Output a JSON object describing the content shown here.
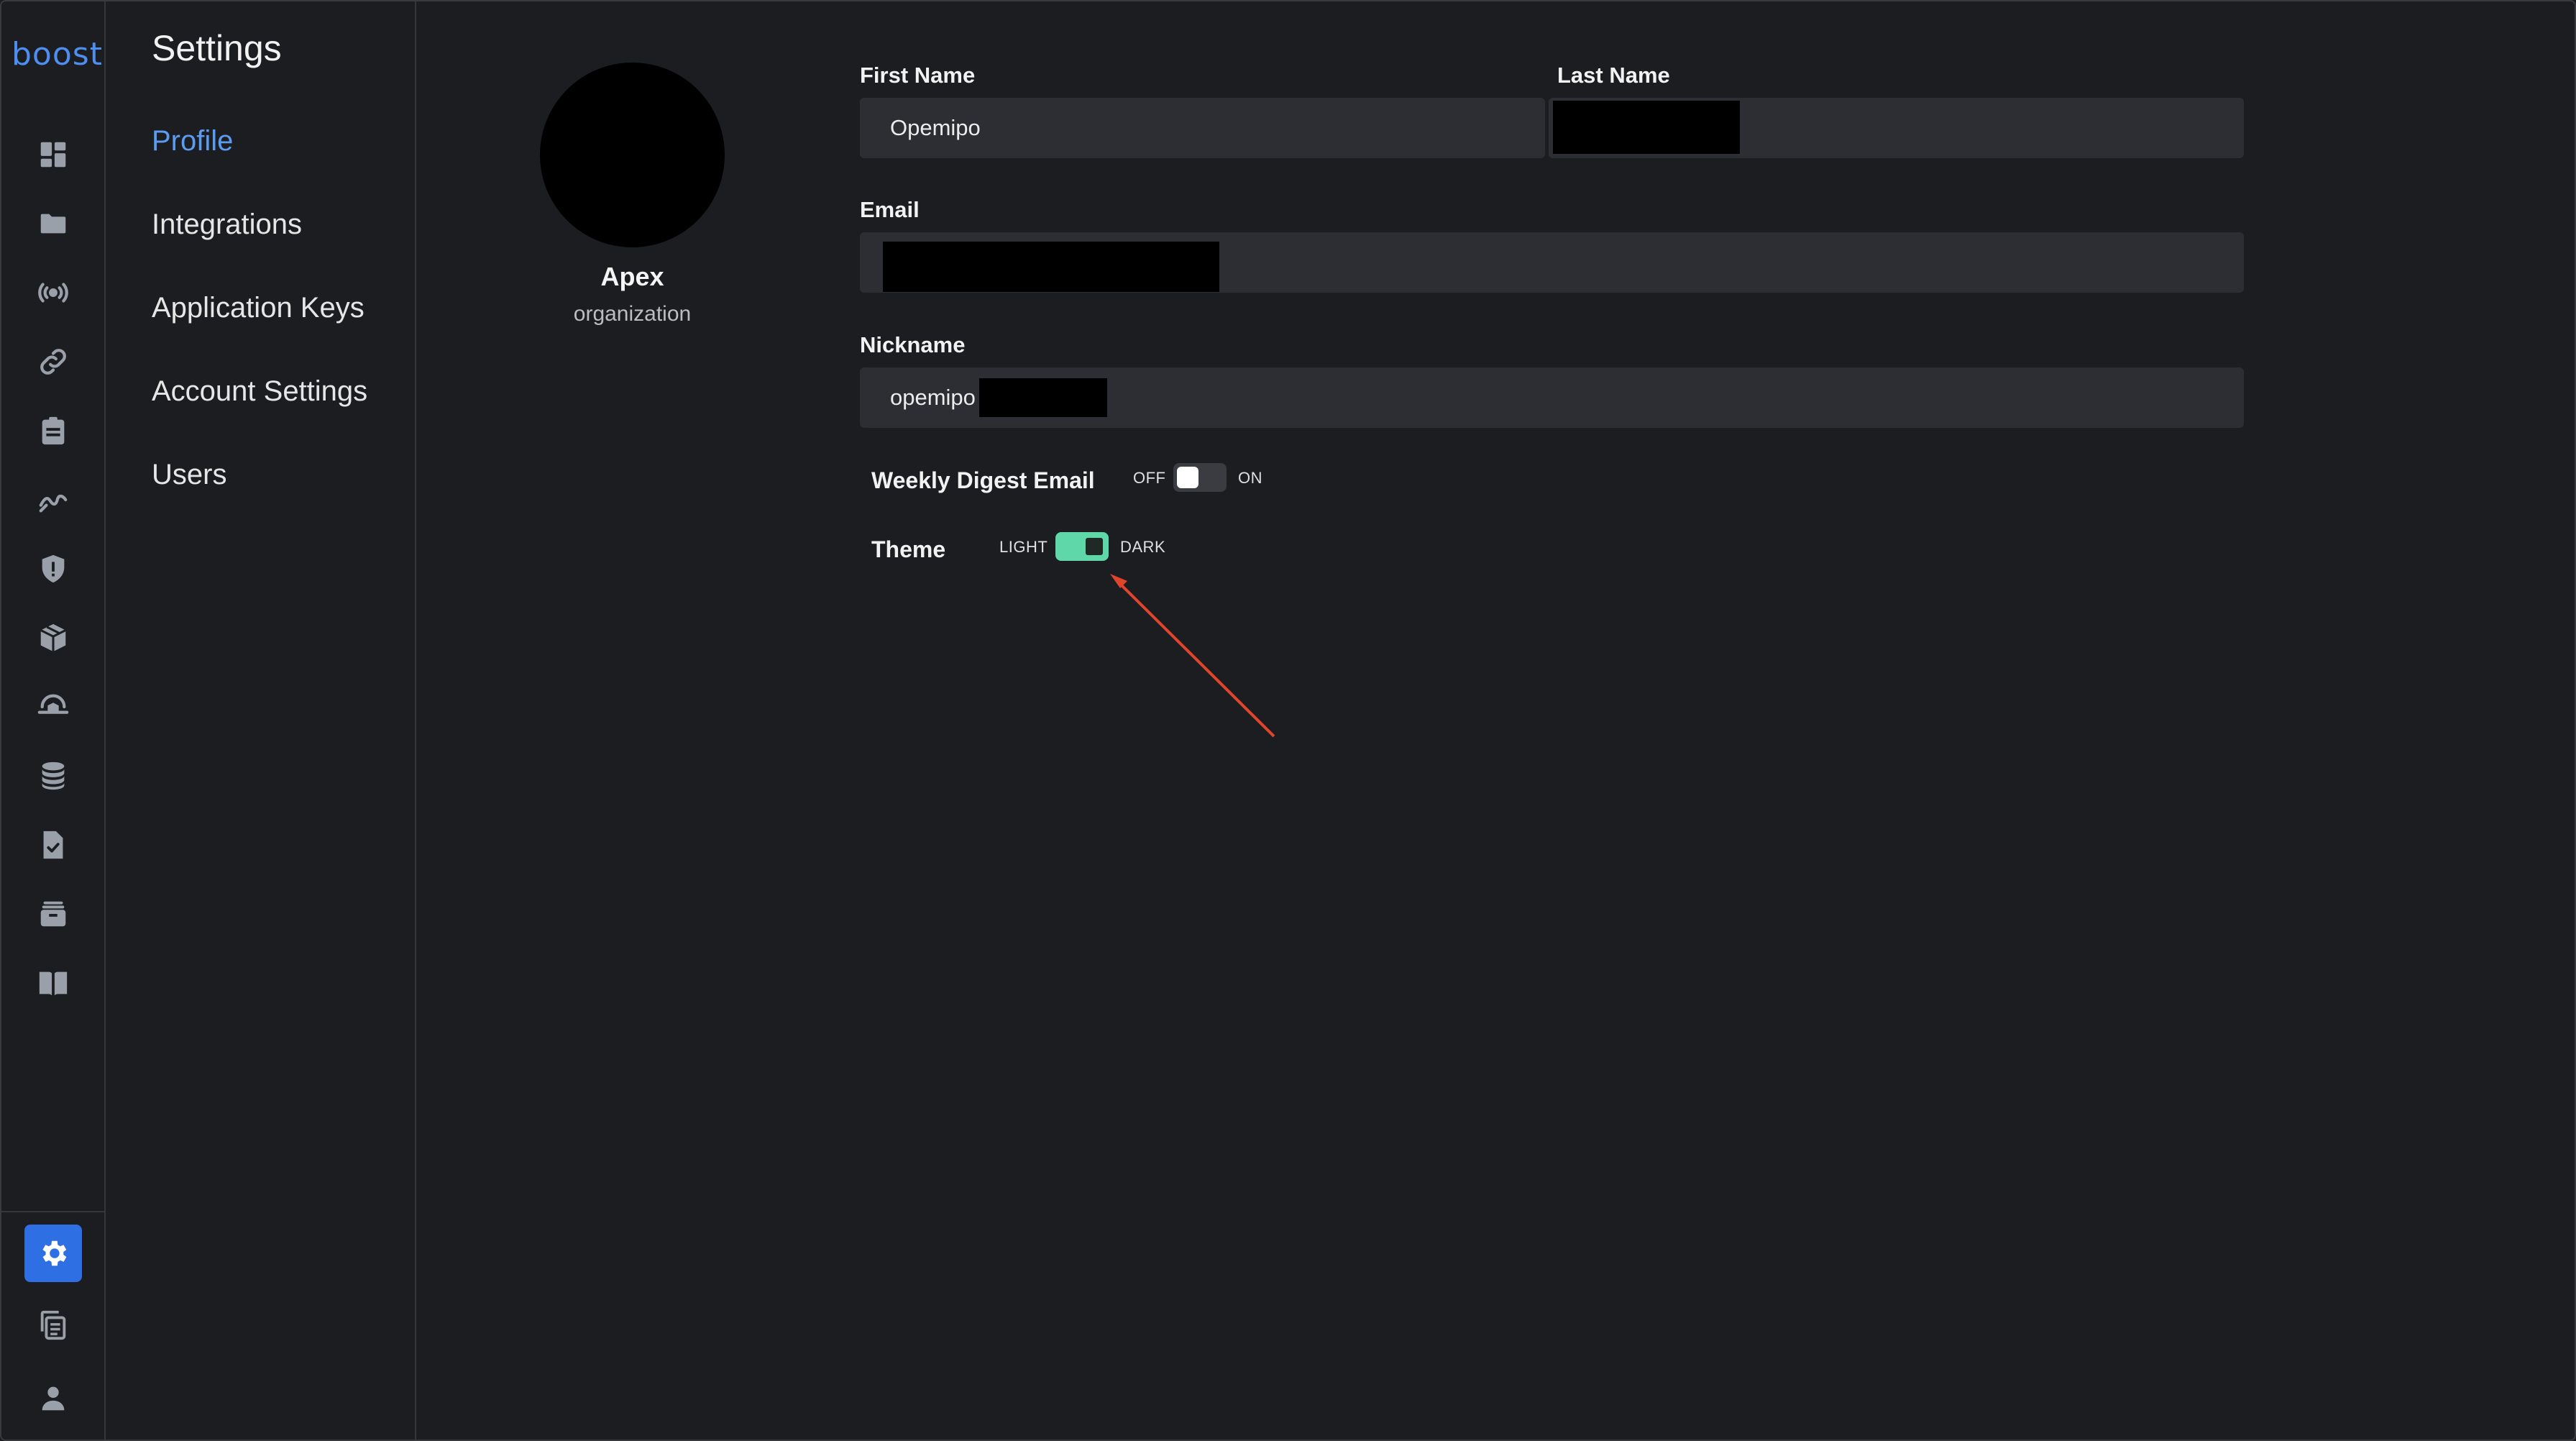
{
  "app": {
    "logo_text": "boost"
  },
  "rail": {
    "icons": [
      "dashboard-icon",
      "folder-icon",
      "broadcast-icon",
      "link-icon",
      "clipboard-icon",
      "trend-icon",
      "shield-icon",
      "box-icon",
      "scanner-icon",
      "database-icon",
      "document-check-icon",
      "archive-icon",
      "book-icon"
    ],
    "bottom_icons": [
      "settings-icon",
      "copy-list-icon",
      "user-icon"
    ]
  },
  "settings": {
    "title": "Settings",
    "nav": [
      {
        "label": "Profile",
        "active": true
      },
      {
        "label": "Integrations",
        "active": false
      },
      {
        "label": "Application Keys",
        "active": false
      },
      {
        "label": "Account Settings",
        "active": false
      },
      {
        "label": "Users",
        "active": false
      }
    ]
  },
  "profile": {
    "org_name": "Apex",
    "org_subtitle": "organization",
    "first_name_label": "First Name",
    "first_name_value": "Opemipo",
    "last_name_label": "Last Name",
    "last_name_value": "",
    "email_label": "Email",
    "email_value": "",
    "nickname_label": "Nickname",
    "nickname_value": "opemipo",
    "weekly_digest_label": "Weekly Digest Email",
    "weekly_digest_off": "OFF",
    "weekly_digest_on": "ON",
    "weekly_digest_enabled": false,
    "theme_label": "Theme",
    "theme_light": "LIGHT",
    "theme_dark": "DARK",
    "theme_dark_enabled": true
  },
  "colors": {
    "accent": "#2f6fe4",
    "active_nav": "#5b9bf0",
    "toggle_on": "#5fd7a9",
    "annotation_arrow": "#e0452b"
  }
}
